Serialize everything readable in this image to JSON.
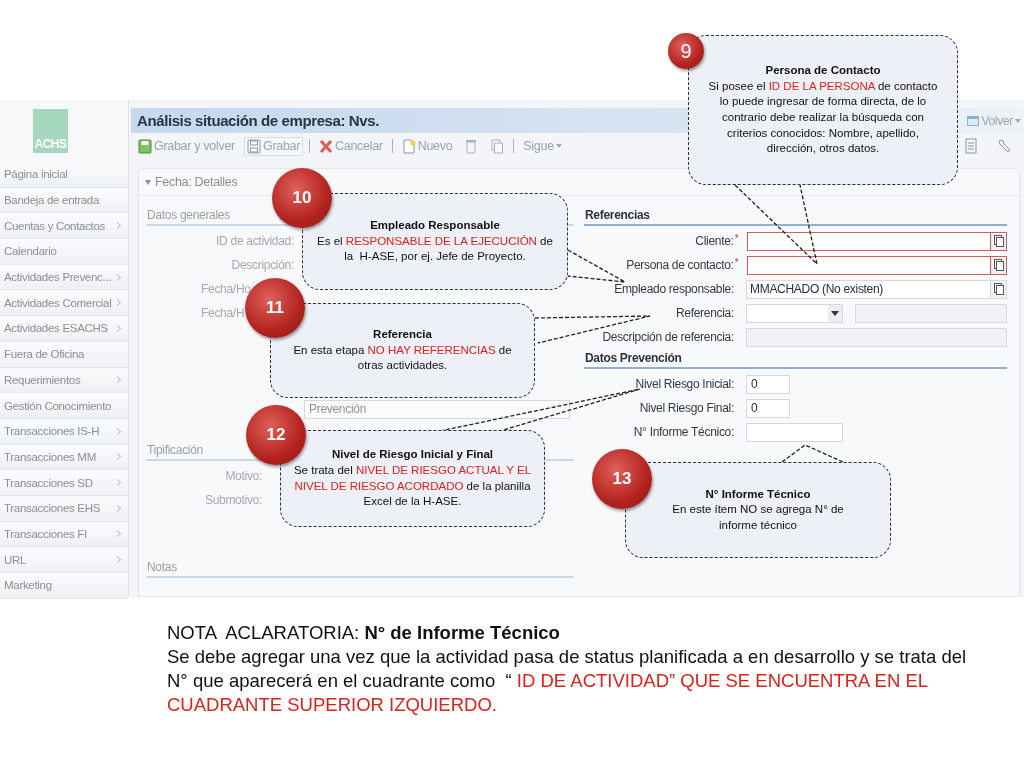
{
  "logo": {
    "text": "ACHS"
  },
  "sidebar": {
    "items": [
      {
        "label": "Página inicial",
        "has_submenu": false
      },
      {
        "label": "Bandeja de entrada",
        "has_submenu": false
      },
      {
        "label": "Cuentas y Contactos",
        "has_submenu": true
      },
      {
        "label": "Calendario",
        "has_submenu": false
      },
      {
        "label": "Actividades Prevenc...",
        "has_submenu": true
      },
      {
        "label": "Actividades Comercial",
        "has_submenu": true
      },
      {
        "label": "Actividades ESACHS",
        "has_submenu": true
      },
      {
        "label": "Fuera de Oficina",
        "has_submenu": false
      },
      {
        "label": "Requerimientos",
        "has_submenu": true
      },
      {
        "label": "Gestión Conocimiento",
        "has_submenu": false
      },
      {
        "label": "Transacciones IS-H",
        "has_submenu": true
      },
      {
        "label": "Transacciones MM",
        "has_submenu": true
      },
      {
        "label": "Transacciones SD",
        "has_submenu": true
      },
      {
        "label": "Transacciones EHS",
        "has_submenu": true
      },
      {
        "label": "Transacciones FI",
        "has_submenu": true
      },
      {
        "label": "URL",
        "has_submenu": true
      },
      {
        "label": "Marketing",
        "has_submenu": false
      }
    ]
  },
  "window": {
    "title": "Análisis situación de empresa: Nvs.",
    "back_button": {
      "label": "Volver"
    }
  },
  "toolbar": [
    {
      "kind": "button",
      "label": "Grabar y volver"
    },
    {
      "kind": "framed_button",
      "label": "Grabar"
    },
    {
      "kind": "separator"
    },
    {
      "kind": "button",
      "label": "Cancelar"
    },
    {
      "kind": "separator"
    },
    {
      "kind": "button",
      "label": "Nuevo"
    },
    {
      "kind": "icon_button"
    },
    {
      "kind": "icon_button"
    },
    {
      "kind": "separator"
    },
    {
      "kind": "menu",
      "label": "Sigue"
    }
  ],
  "section": {
    "title": "Fecha: Detalles",
    "expanded": true
  },
  "form": {
    "left": [
      {
        "kind": "heading",
        "text": "Datos generales"
      },
      {
        "kind": "label",
        "label": "ID de actividad:"
      },
      {
        "kind": "label",
        "label": "Descripción:"
      },
      {
        "kind": "partial",
        "label": "Fecha/Ho"
      },
      {
        "kind": "partial",
        "label": "Fecha/H"
      },
      {
        "kind": "input",
        "value": "Prevención"
      },
      {
        "kind": "heading",
        "text": "Tipificación"
      },
      {
        "kind": "label",
        "label": "Motivo:"
      },
      {
        "kind": "label",
        "label": "Submotivo:"
      },
      {
        "kind": "heading",
        "text": "Notas"
      }
    ],
    "right": [
      {
        "kind": "heading",
        "text": "Referencias"
      },
      {
        "kind": "lookup",
        "label": "Cliente:",
        "marker": "*",
        "required": true
      },
      {
        "kind": "lookup",
        "label": "Persona de contacto:",
        "marker": "*",
        "required": true
      },
      {
        "kind": "lookup",
        "label": "Empleado responsable:",
        "value": "MMACHADO (No existen)",
        "required": false
      },
      {
        "kind": "select_pair",
        "label": "Referencia:"
      },
      {
        "kind": "disabled",
        "label": "Descripción de referencia:"
      },
      {
        "kind": "heading",
        "text": "Datos Prevención"
      },
      {
        "kind": "short",
        "label": "Nivel Riesgo Inicial:",
        "value": "0"
      },
      {
        "kind": "short",
        "label": "Nivel Riesgo Final:",
        "value": "0"
      },
      {
        "kind": "medium",
        "label": "N° Informe Técnico:"
      }
    ]
  },
  "callouts": [
    {
      "number": "9",
      "title": "Persona de Contacto",
      "body": [
        {
          "text": "Si posee el "
        },
        {
          "text": "ID DE LA PERSONA",
          "highlight": true
        },
        {
          "text": " de contacto lo puede ingresar de forma directa, de lo contrario debe realizar la búsqueda con criterios conocidos: Nombre, apellido, dirección, otros datos."
        }
      ]
    },
    {
      "number": "10",
      "title": "Empleado Responsable",
      "body": [
        {
          "text": "Es el "
        },
        {
          "text": "RESPONSABLE DE LA EJECUCIÓN",
          "highlight": true
        },
        {
          "text": " de la  H-ASE, por ej. Jefe de Proyecto."
        }
      ]
    },
    {
      "number": "11",
      "title": "Referencia",
      "body": [
        {
          "text": "En esta etapa "
        },
        {
          "text": "NO HAY REFERENCIAS",
          "highlight": true
        },
        {
          "text": " de otras actividades."
        }
      ]
    },
    {
      "number": "12",
      "title": "Nivel de Riesgo Inicial y Final",
      "body": [
        {
          "text": "Se trata del "
        },
        {
          "text": "NIVEL DE RIESGO ACTUAL Y EL NIVEL DE RIESGO ACORDADO",
          "highlight": true
        },
        {
          "text": " de la planilla Excel de la H-ASE."
        }
      ]
    },
    {
      "number": "13",
      "title": "N° Informe Técnico",
      "body": [
        {
          "text": "En este ítem NO se agrega N° de informe técnico"
        }
      ]
    }
  ],
  "note": {
    "heading": "NOTA  ACLARATORIA: **N° de Informe Técnico**",
    "body": [
      {
        "text": "Se debe agregar una vez que la actividad pasa de status planificada a en desarrollo y se trata del N° que aparecerá en el cuadrante como  “ "
      },
      {
        "text": "ID DE ACTIVIDAD” QUE SE ENCUENTRA EN EL CUADRANTE SUPERIOR IZQUIERDO.",
        "highlight": true
      }
    ]
  }
}
